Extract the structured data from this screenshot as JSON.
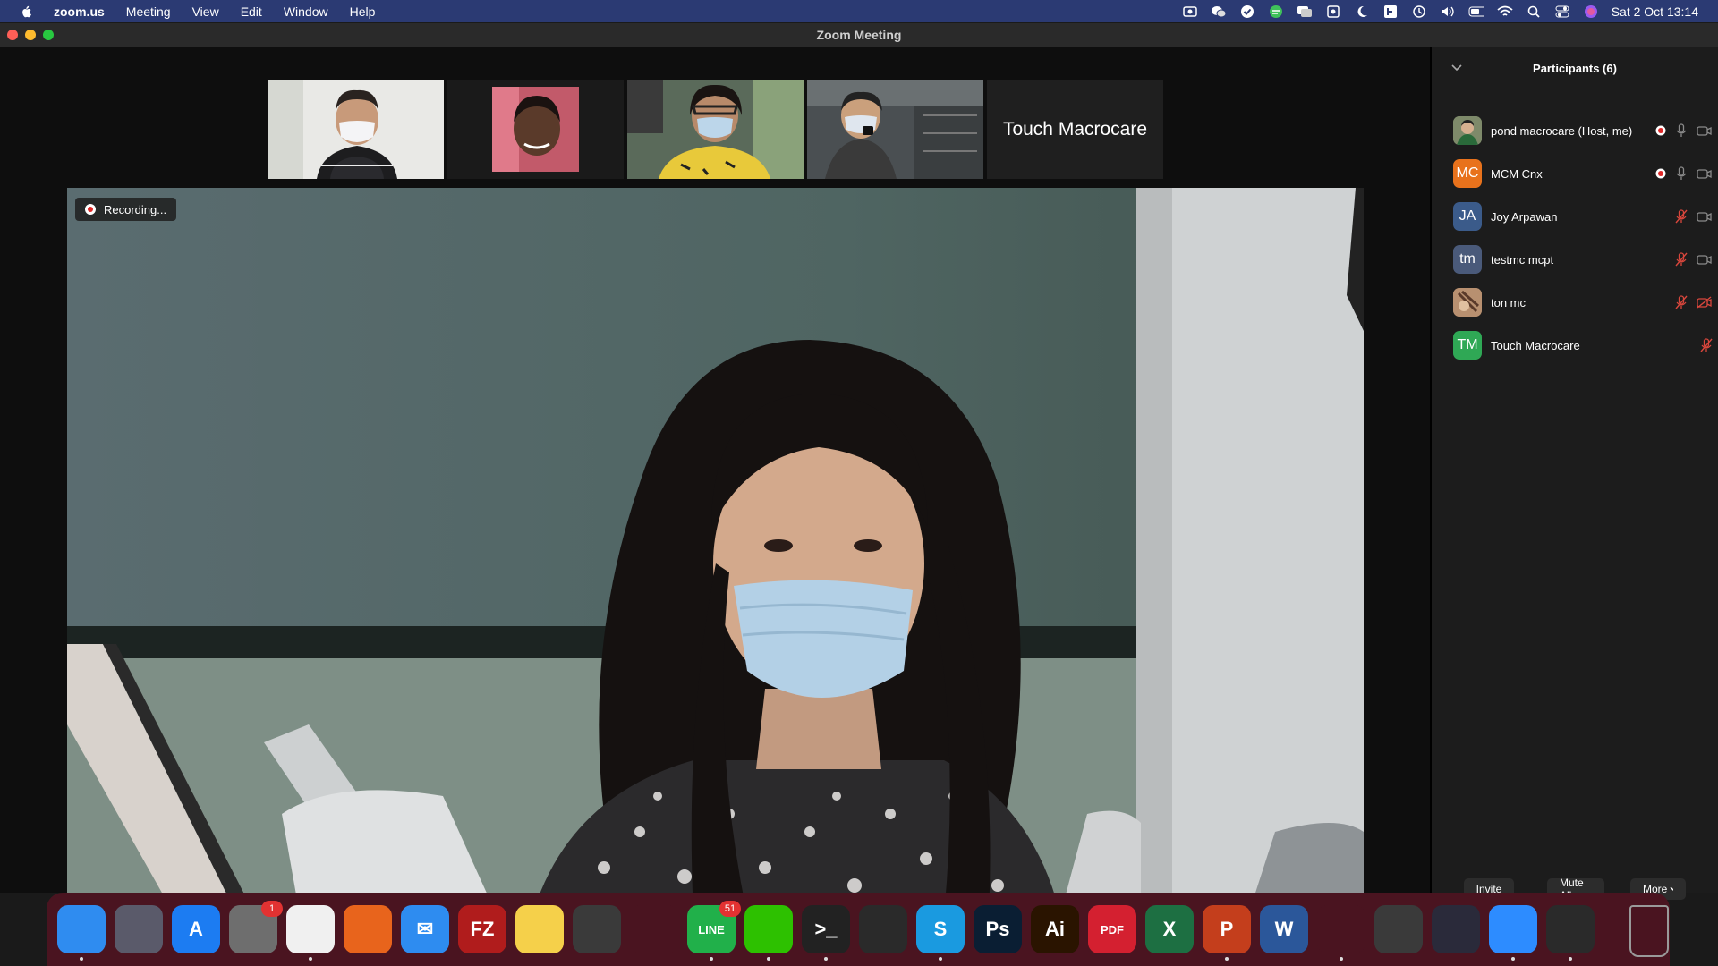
{
  "menubar": {
    "app_name": "zoom.us",
    "menus": [
      "Meeting",
      "View",
      "Edit",
      "Window",
      "Help"
    ],
    "datetime": "Sat 2 Oct  13:14",
    "status_icons": [
      "screen-record-icon",
      "wechat-icon",
      "checkmark-icon",
      "chat-icon",
      "message-icon",
      "screen-icon",
      "moon-icon",
      "text-icon",
      "time-machine-icon",
      "volume-icon",
      "battery-icon",
      "wifi-icon",
      "search-icon",
      "control-center-icon",
      "siri-icon"
    ]
  },
  "window": {
    "title": "Zoom Meeting"
  },
  "thumbnails": [
    {
      "type": "video",
      "name": "participant-1"
    },
    {
      "type": "video",
      "name": "participant-2"
    },
    {
      "type": "video",
      "name": "participant-3"
    },
    {
      "type": "video",
      "name": "participant-4"
    },
    {
      "type": "name",
      "label": "Touch Macrocare"
    }
  ],
  "recording": {
    "label": "Recording..."
  },
  "participants": {
    "title": "Participants (6)",
    "list": [
      {
        "name": "pond macrocare  (Host, me)",
        "initials": "",
        "color": "#6a7a5a",
        "photo": true,
        "status": "recording-on",
        "mic": "on",
        "video": "on"
      },
      {
        "name": "MCM Cnx",
        "initials": "MC",
        "color": "#e8721c",
        "photo": false,
        "status": "recording-on",
        "mic": "on",
        "video": "on"
      },
      {
        "name": "Joy Arpawan",
        "initials": "JA",
        "color": "#3b5b8a",
        "photo": false,
        "status": "",
        "mic": "muted",
        "video": "on"
      },
      {
        "name": "testmc mcpt",
        "initials": "tm",
        "color": "#4a5a7a",
        "photo": false,
        "status": "",
        "mic": "muted",
        "video": "on"
      },
      {
        "name": "ton mc",
        "initials": "",
        "color": "#8a6a5a",
        "photo": true,
        "status": "",
        "mic": "muted",
        "video": "off"
      },
      {
        "name": "Touch Macrocare",
        "initials": "TM",
        "color": "#2fa855",
        "photo": false,
        "status": "",
        "mic": "muted",
        "video": "none"
      }
    ],
    "buttons": {
      "invite": "Invite",
      "mute_all": "Mute All",
      "more": "More"
    }
  },
  "dock": {
    "apps": [
      {
        "name": "finder",
        "color": "#2f8cf0",
        "label": ""
      },
      {
        "name": "launchpad",
        "color": "#5a5a6a",
        "label": ""
      },
      {
        "name": "app-store",
        "color": "#1c7cf2",
        "label": "A"
      },
      {
        "name": "system-preferences",
        "color": "#6e6e6e",
        "label": "",
        "badge": "1"
      },
      {
        "name": "chrome",
        "color": "#f0f0f0",
        "label": ""
      },
      {
        "name": "firefox",
        "color": "#e8641c",
        "label": ""
      },
      {
        "name": "mail",
        "color": "#2e8cf0",
        "label": "✉"
      },
      {
        "name": "filezilla",
        "color": "#b01c1c",
        "label": "FZ"
      },
      {
        "name": "notes",
        "color": "#f5d04a",
        "label": ""
      },
      {
        "name": "calculator",
        "color": "#3a3a3a",
        "label": ""
      },
      {
        "name": "vlc",
        "color": "#4a1420",
        "label": ""
      },
      {
        "name": "line",
        "color": "#21b04a",
        "label": "LINE",
        "badge": "51"
      },
      {
        "name": "wechat",
        "color": "#2dc100",
        "label": ""
      },
      {
        "name": "terminal",
        "color": "#222222",
        "label": ">_"
      },
      {
        "name": "vscode",
        "color": "#2a2a2a",
        "label": ""
      },
      {
        "name": "skype",
        "color": "#1a9ae0",
        "label": "S"
      },
      {
        "name": "photoshop",
        "color": "#0a1e33",
        "label": "Ps"
      },
      {
        "name": "illustrator",
        "color": "#2a1400",
        "label": "Ai"
      },
      {
        "name": "pdf-app",
        "color": "#d42030",
        "label": "PDF"
      },
      {
        "name": "excel",
        "color": "#1d6f42",
        "label": "X"
      },
      {
        "name": "powerpoint",
        "color": "#c43e1c",
        "label": "P"
      },
      {
        "name": "word",
        "color": "#2b579a",
        "label": "W"
      },
      {
        "name": "fruit-app",
        "color": "#4a1420",
        "label": ""
      },
      {
        "name": "final-cut",
        "color": "#3a3a3a",
        "label": ""
      },
      {
        "name": "activity-clock",
        "color": "#2a2a3a",
        "label": ""
      },
      {
        "name": "zoom",
        "color": "#2d8cff",
        "label": ""
      },
      {
        "name": "piano-app",
        "color": "#2a2a2a",
        "label": ""
      },
      {
        "name": "trash",
        "color": "#5a5a5a",
        "label": ""
      }
    ]
  }
}
